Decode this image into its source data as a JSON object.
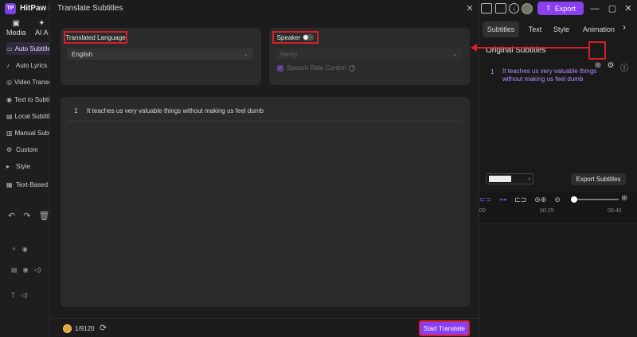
{
  "app": {
    "title": "HitPaw Ed",
    "logo_text": "TP",
    "export_label": "Export",
    "window_controls": [
      "—",
      "▢",
      "✕"
    ]
  },
  "left_panel": {
    "tabs": [
      {
        "label": "Media",
        "icon": "media-icon"
      },
      {
        "label": "AI A",
        "icon": "ai-icon"
      }
    ],
    "items": [
      {
        "label": "Auto Subtitles",
        "icon": "cc-icon",
        "active": true
      },
      {
        "label": "Auto Lyrics",
        "icon": "music-icon",
        "active": false
      },
      {
        "label": "Video Transcription",
        "icon": "video-transcription-icon",
        "active": false
      },
      {
        "label": "Text to Subtitles",
        "icon": "text-to-subtitles-icon",
        "active": false
      },
      {
        "label": "Local Subtitles",
        "icon": "local-subtitles-icon",
        "active": false
      },
      {
        "label": "Manual Subtitles",
        "icon": "manual-subtitles-icon",
        "active": false
      },
      {
        "label": "Custom",
        "icon": "custom-icon",
        "active": false
      },
      {
        "label": "Style",
        "icon": "caret-right-icon",
        "active": false
      },
      {
        "label": "Text-Based",
        "icon": "text-based-icon",
        "active": false
      }
    ]
  },
  "right_panel": {
    "tabs": [
      {
        "label": "Subtitles",
        "active": true
      },
      {
        "label": "Text",
        "active": false
      },
      {
        "label": "Style",
        "active": false
      },
      {
        "label": "Animation",
        "active": false
      }
    ],
    "section_title": "Original Subtitles",
    "subtitle_number": "1",
    "subtitle_text": "It teaches us very valuable things without making us feel dumb",
    "export_subtitles_label": "Export Subtitles"
  },
  "timeline": {
    "ruler": [
      "00",
      "00:25",
      "00:40"
    ]
  },
  "modal": {
    "title": "Translate Subtitles",
    "translated_language_label": "Translated Language",
    "translated_language_value": "English",
    "speaker_label": "Speaker",
    "speaker_enabled": false,
    "voice_value": "Henry",
    "speech_rate_label": "Speech Rate Control",
    "rows": [
      {
        "num": "1",
        "text": "It teaches us very valuable things without making us feel dumb"
      }
    ],
    "credits": "1/9120",
    "start_label": "Start Translate"
  },
  "colors": {
    "accent": "#8a3ff0",
    "annotation": "#d61f26",
    "subtitle_text": "#b58cff"
  }
}
